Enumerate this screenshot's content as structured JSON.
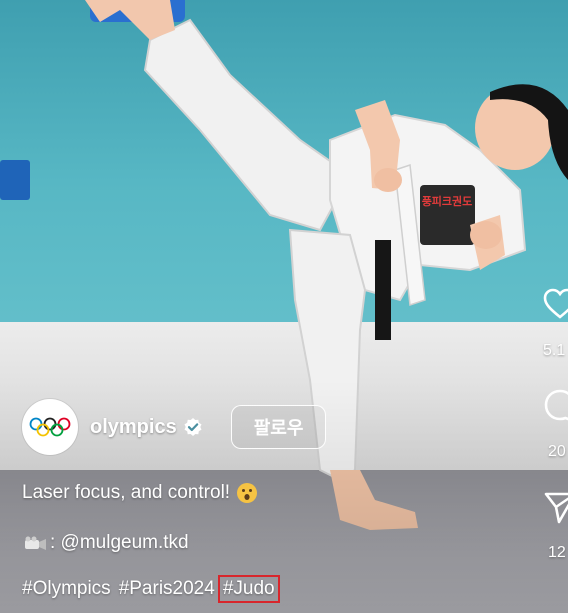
{
  "post": {
    "author": "olympics",
    "follow_label": "팔로우",
    "caption": "Laser focus, and control!",
    "credit": ": @mulgeum.tkd",
    "hashtags": [
      "#Olympics",
      "#Paris2024",
      "#Judo"
    ],
    "highlighted_hashtag": "#Judo",
    "uniform_text": "풍피크권도"
  },
  "actions": {
    "like_count": "5.1",
    "comment_count": "20",
    "share_count": "12"
  },
  "colors": {
    "highlight": "#d8262c",
    "text": "#ffffff",
    "wall": "#4aa9b8"
  }
}
